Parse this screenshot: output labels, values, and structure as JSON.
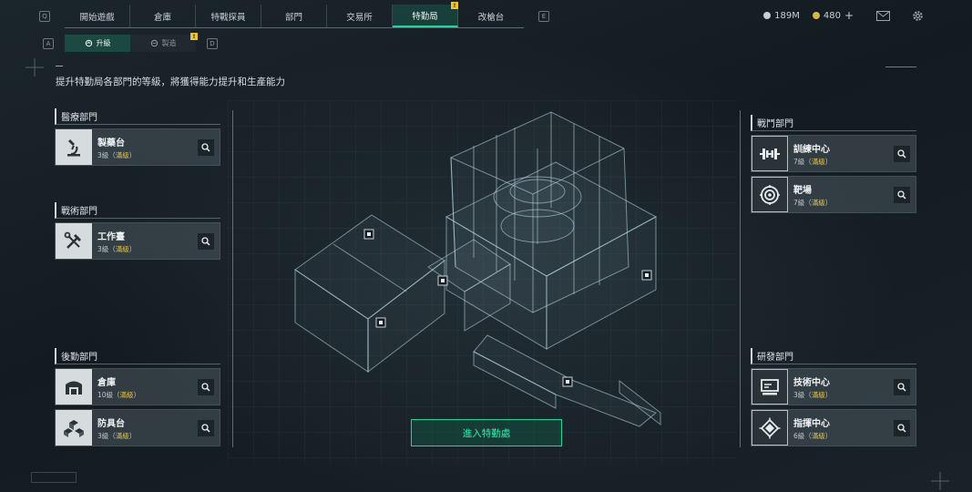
{
  "top_nav": {
    "left_key": "Q",
    "right_key": "E",
    "tabs": [
      {
        "label": "開始遊戲"
      },
      {
        "label": "倉庫"
      },
      {
        "label": "特戰探員"
      },
      {
        "label": "部門"
      },
      {
        "label": "交易所"
      },
      {
        "label": "特勤局",
        "active": true,
        "badge": "!"
      },
      {
        "label": "改槍台"
      }
    ]
  },
  "currencies": {
    "silver": "189M",
    "gold": "480",
    "gold_add": "+"
  },
  "sub_nav": {
    "left_key": "A",
    "right_key": "D",
    "tabs": [
      {
        "label": "升級",
        "active": true
      },
      {
        "label": "製造",
        "badge": "!"
      }
    ]
  },
  "description": "提升特勤局各部門的等級，將獲得能力提升和生產能力",
  "enter_button": "進入特勤處",
  "departments": {
    "medical": {
      "title": "醫療部門",
      "facilities": [
        {
          "name": "製藥台",
          "level": "3級",
          "status": "滿級",
          "icon": "microscope-icon"
        }
      ]
    },
    "tactical": {
      "title": "戰術部門",
      "facilities": [
        {
          "name": "工作臺",
          "level": "3級",
          "status": "滿級",
          "icon": "tools-icon"
        }
      ]
    },
    "logistics": {
      "title": "後勤部門",
      "facilities": [
        {
          "name": "倉庫",
          "level": "10級",
          "status": "滿級",
          "icon": "warehouse-icon"
        },
        {
          "name": "防具台",
          "level": "3級",
          "status": "滿級",
          "icon": "cubes-icon"
        }
      ]
    },
    "combat": {
      "title": "戰鬥部門",
      "facilities": [
        {
          "name": "訓練中心",
          "level": "7級",
          "status": "滿級",
          "icon": "dumbbell-icon"
        },
        {
          "name": "靶場",
          "level": "7級",
          "status": "滿級",
          "icon": "target-icon"
        }
      ]
    },
    "research": {
      "title": "研發部門",
      "facilities": [
        {
          "name": "技術中心",
          "level": "3級",
          "status": "滿級",
          "icon": "computer-icon"
        },
        {
          "name": "指揮中心",
          "level": "6級",
          "status": "滿級",
          "icon": "command-chip-icon"
        }
      ]
    }
  },
  "colors": {
    "accent": "#1fd59a",
    "max_level": "#e3c04a",
    "badge": "#e8c43a"
  }
}
